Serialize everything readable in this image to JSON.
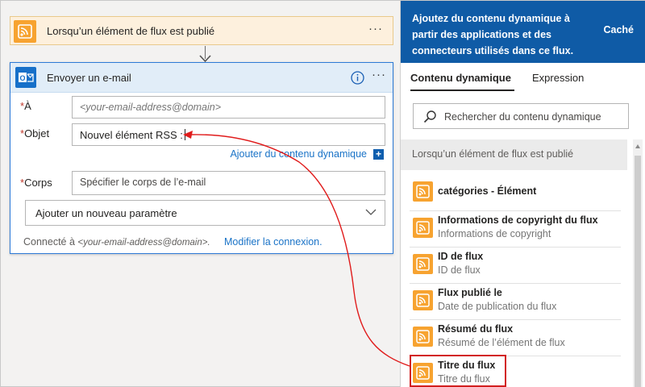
{
  "trigger": {
    "title": "Lorsqu’un élément de flux est publié",
    "more": "···",
    "icon": "rss-icon"
  },
  "email_action": {
    "title": "Envoyer un e-mail",
    "icon": "outlook-icon",
    "more": "···",
    "fields": {
      "to": {
        "required_mark": "*",
        "label": "À",
        "placeholder": "<your-email-address@domain>"
      },
      "subject": {
        "required_mark": "*",
        "label": "Objet",
        "value": "Nouvel élément RSS :"
      },
      "body": {
        "required_mark": "*",
        "label": "Corps",
        "placeholder": "Spécifier le corps de l’e-mail"
      }
    },
    "add_dynamic_content": "Ajouter du contenu dynamique",
    "add_param": "Ajouter un nouveau paramètre",
    "connected_prefix": "Connecté à ",
    "connected_email": "<your-email-address@domain>.",
    "change_connection": "Modifier la connexion."
  },
  "panel": {
    "banner_text": "Ajoutez du contenu dynamique à partir des applications et des connecteurs utilisés dans ce flux.",
    "hide": "Caché",
    "tabs": [
      "Contenu dynamique",
      "Expression"
    ],
    "active_tab": "Contenu dynamique",
    "search_placeholder": "Rechercher du contenu dynamique",
    "group_title": "Lorsqu’un élément de flux est publié",
    "items": [
      {
        "title": "catégories - Élément",
        "subtitle": ""
      },
      {
        "title": "Informations de copyright du flux",
        "subtitle": "Informations de copyright"
      },
      {
        "title": "ID de flux",
        "subtitle": "ID de flux"
      },
      {
        "title": "Flux publié le",
        "subtitle": "Date de publication du flux"
      },
      {
        "title": "Résumé du flux",
        "subtitle": "Résumé de l’élément de flux"
      },
      {
        "title": "Titre du flux",
        "subtitle": "Titre du flux"
      }
    ],
    "highlighted_item": "Titre du flux"
  },
  "colors": {
    "accent_blue": "#0f5ba6",
    "rss_orange": "#f7a330",
    "trigger_bg": "#fdf0dd",
    "highlight_red": "#d21f1f"
  }
}
